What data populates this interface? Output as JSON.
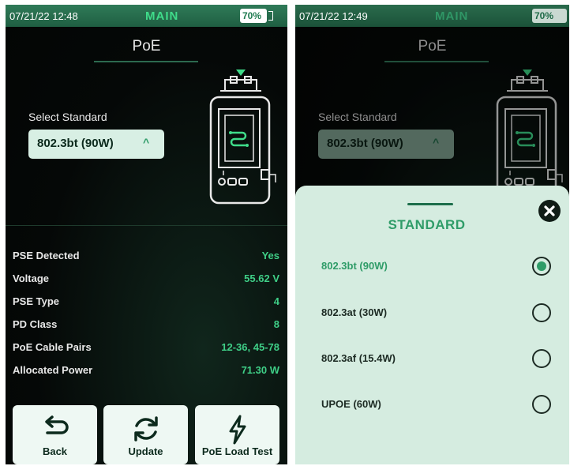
{
  "left": {
    "status": {
      "time": "07/21/22 12:48",
      "mode": "MAIN",
      "battery": "70%"
    },
    "title": "PoE",
    "select_label": "Select Standard",
    "select_value": "802.3bt (90W)",
    "readings": [
      {
        "label": "PSE Detected",
        "value": "Yes"
      },
      {
        "label": "Voltage",
        "value": "55.62 V"
      },
      {
        "label": "PSE Type",
        "value": "4"
      },
      {
        "label": "PD Class",
        "value": "8"
      },
      {
        "label": "PoE Cable Pairs",
        "value": "12-36, 45-78"
      },
      {
        "label": "Allocated Power",
        "value": "71.30 W"
      }
    ],
    "buttons": {
      "back": "Back",
      "update": "Update",
      "poe_load": "PoE Load Test"
    }
  },
  "right": {
    "status": {
      "time": "07/21/22 12:49",
      "mode": "MAIN",
      "battery": "70%"
    },
    "title": "PoE",
    "select_label": "Select Standard",
    "select_value": "802.3bt (90W)",
    "sheet": {
      "title": "STANDARD",
      "options": [
        {
          "label": "802.3bt (90W)",
          "selected": true
        },
        {
          "label": "802.3at (30W)",
          "selected": false
        },
        {
          "label": "802.3af (15.4W)",
          "selected": false
        },
        {
          "label": "UPOE (60W)",
          "selected": false
        }
      ]
    }
  },
  "colors": {
    "accent": "#3fcf87",
    "status_bar": "#2a7352",
    "sheet_bg": "#d5ece0"
  }
}
